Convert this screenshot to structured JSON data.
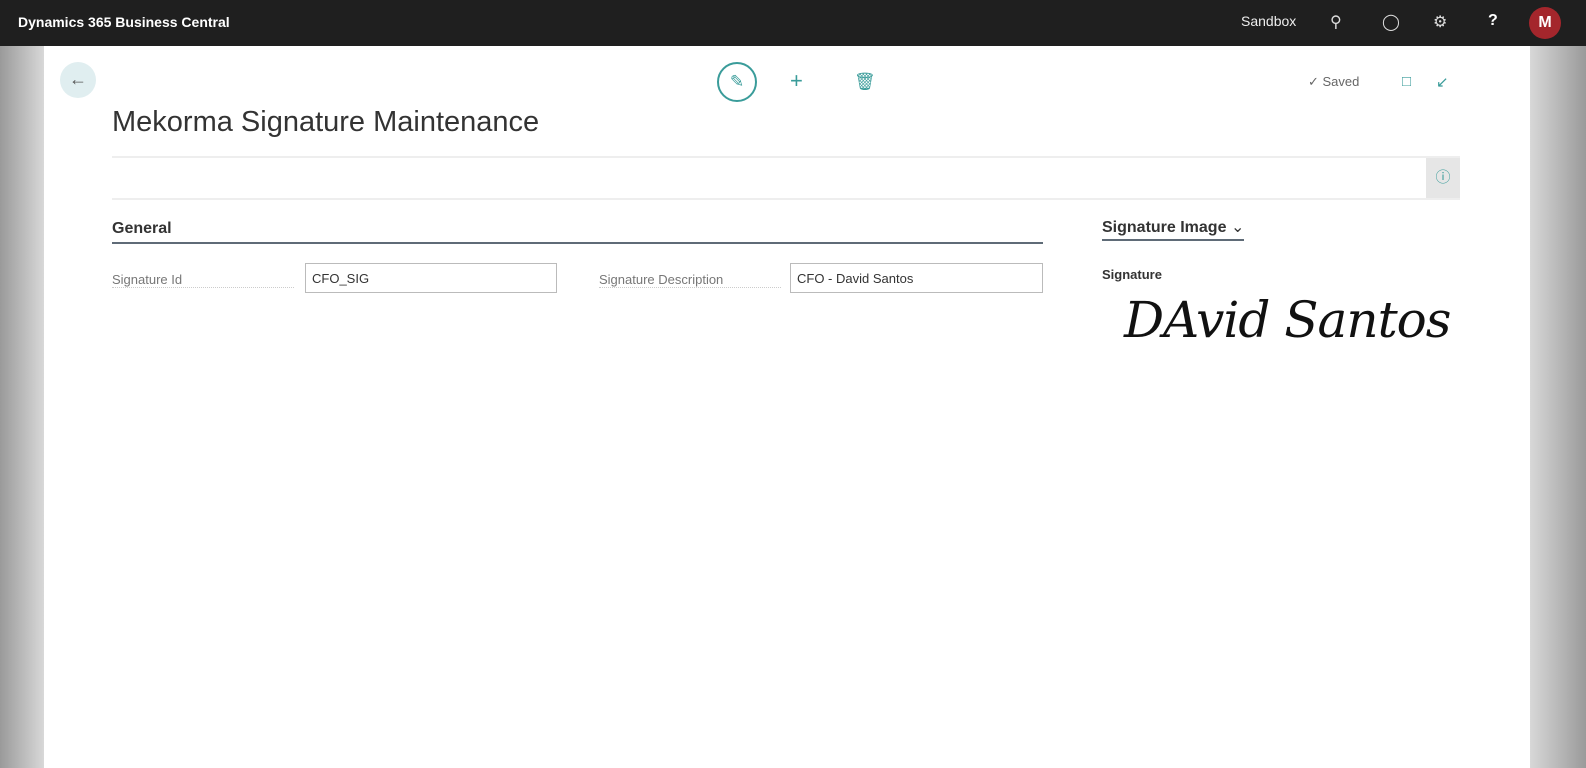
{
  "topbar": {
    "app_title": "Dynamics 365 Business Central",
    "environment": "Sandbox",
    "avatar_initial": "M",
    "help": "?"
  },
  "toolbar": {
    "status": "✓ Saved"
  },
  "page": {
    "title": "Mekorma Signature Maintenance"
  },
  "general": {
    "heading": "General",
    "fields": [
      {
        "label": "Signature Id",
        "value": "CFO_SIG"
      },
      {
        "label": "Signature Description",
        "value": "CFO - David Santos"
      }
    ]
  },
  "factbox": {
    "heading": "Signature Image",
    "field_label": "Signature",
    "signature_text": "DAvid Santos"
  },
  "colors": {
    "accent": "#3a9c9a",
    "topbar": "#1f1f1f",
    "avatar": "#a4262c"
  }
}
